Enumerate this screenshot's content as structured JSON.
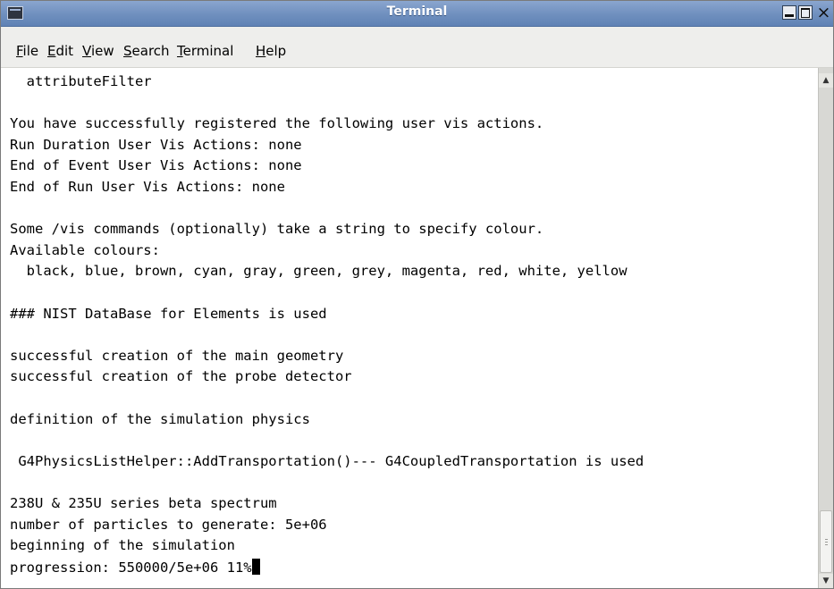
{
  "window": {
    "title": "Terminal",
    "close_symbol": "×"
  },
  "menu": {
    "items": [
      {
        "mnemonic": "F",
        "rest": "ile"
      },
      {
        "mnemonic": "E",
        "rest": "dit"
      },
      {
        "mnemonic": "V",
        "rest": "iew"
      },
      {
        "mnemonic": "S",
        "rest": "earch"
      },
      {
        "mnemonic": "T",
        "rest": "erminal"
      },
      {
        "mnemonic": "H",
        "rest": "elp"
      }
    ]
  },
  "terminal": {
    "lines": [
      "  attributeFilter",
      "",
      "You have successfully registered the following user vis actions.",
      "Run Duration User Vis Actions: none",
      "End of Event User Vis Actions: none",
      "End of Run User Vis Actions: none",
      "",
      "Some /vis commands (optionally) take a string to specify colour.",
      "Available colours:",
      "  black, blue, brown, cyan, gray, green, grey, magenta, red, white, yellow",
      "",
      "### NIST DataBase for Elements is used",
      "",
      "successful creation of the main geometry",
      "successful creation of the probe detector",
      "",
      "definition of the simulation physics",
      "",
      " G4PhysicsListHelper::AddTransportation()--- G4CoupledTransportation is used",
      "",
      "238U & 235U series beta spectrum",
      "number of particles to generate: 5e+06",
      "beginning of the simulation",
      "progression: 550000/5e+06 11%"
    ]
  },
  "icons": {
    "app": "terminal-icon",
    "minimize": "minimize-icon",
    "maximize": "maximize-icon",
    "close": "close-icon",
    "scroll_up": "scroll-up-arrow-icon",
    "scroll_down": "scroll-down-arrow-icon"
  },
  "scrollbar": {
    "position": "bottom"
  }
}
